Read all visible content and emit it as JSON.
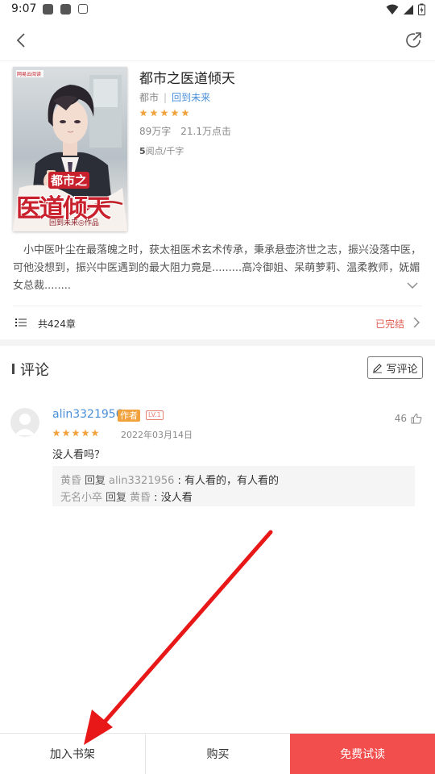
{
  "status_bar": {
    "time": "9:07"
  },
  "book": {
    "title": "都市之医道倾天",
    "category": "都市",
    "author": "回到未来",
    "rating_stars": 5,
    "word_count": "89万字",
    "clicks": "21.1万点击",
    "price_value": "5",
    "price_unit": "阅点/千字",
    "cover": {
      "publisher": "网易云阅读",
      "title_line1": "都市之",
      "title_line2": "医道倾天",
      "author_line": "回到未来◎作品"
    },
    "intro": "小中医叶尘在最落魄之时，获太祖医术玄术传承，秉承悬壶济世之志，振兴没落中医，可他没想到，振兴中医遇到的最大阻力竟是.........高冷御姐、呆萌萝莉、温柔教师，妩媚女总裁........",
    "chapter_count": "共424章",
    "status": "已完结"
  },
  "comments": {
    "title": "评论",
    "write_label": "写评论",
    "items": [
      {
        "user": "alin3321956",
        "badge": "作者",
        "level": "LV.1",
        "stars": 5,
        "date": "2022年03月14日",
        "likes": "46",
        "text": "没人看吗？",
        "replies": [
          {
            "from": "黄昏",
            "verb": "回复",
            "to": "alin3321956",
            "text": "有人看的，有人看的"
          },
          {
            "from": "无名小卒",
            "verb": "回复",
            "to": "黄昏",
            "text": "没人看"
          }
        ]
      }
    ]
  },
  "bottom_bar": {
    "add_shelf": "加入书架",
    "buy": "购买",
    "free_read": "免费试读"
  },
  "colors": {
    "accent_red": "#f24e4e",
    "link_blue": "#4a90d9",
    "star_orange": "#f2a23c",
    "annotation_arrow": "#e81818"
  },
  "icons": [
    "back-arrow-icon",
    "share-icon",
    "star-icon",
    "chevron-down-icon",
    "list-icon",
    "chevron-right-icon",
    "pencil-icon",
    "thumbs-up-icon",
    "avatar-placeholder-icon"
  ]
}
